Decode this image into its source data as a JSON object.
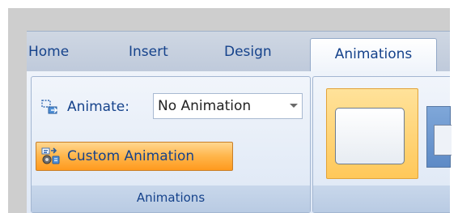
{
  "ribbon": {
    "tabs": [
      {
        "label": "Home"
      },
      {
        "label": "Insert"
      },
      {
        "label": "Design"
      },
      {
        "label": "Animations",
        "active": true
      }
    ],
    "animations_group": {
      "label": "Animations",
      "animate_label": "Animate:",
      "animate_value": "No Animation",
      "custom_animation_label": "Custom Animation"
    },
    "transition_group": {
      "label": ""
    }
  },
  "icons": {
    "animate": "animate-icon",
    "custom_animation": "custom-animation-icon",
    "dropdown": "chevron-down-icon"
  },
  "colors": {
    "tab_text": "#15428b",
    "highlight": "#ffb54a"
  }
}
